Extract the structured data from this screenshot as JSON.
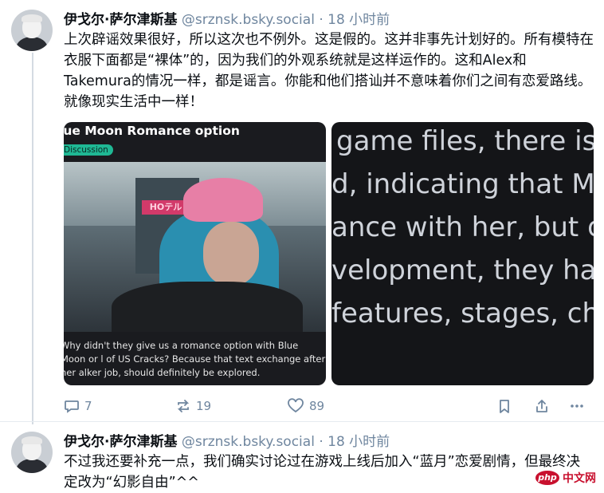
{
  "post1": {
    "display_name": "伊戈尔·萨尔津斯基",
    "handle": "@srznsk.bsky.social",
    "separator": "·",
    "time": "18 小时前",
    "text": "上次辟谣效果很好，所以这次也不例外。这是假的。这并非事先计划好的。所有模特在衣服下面都是“裸体”的，因为我们的外观系统就是这样运作的。这和Alex和Takemura的情况一样，都是谣言。你能和他们搭讪并不意味着你们之间有恋爱路线。就像现实生活中一样！",
    "media_left": {
      "title": "lue Moon Romance option",
      "tag": "Discussion",
      "sign_text": "HOテル",
      "caption": "Why didn't they give us a romance option with Blue Moon or l of US Cracks? Because that text exchange after her alker job, should definitely be explored."
    },
    "media_right": {
      "lines": [
        "game files, there is a",
        "d, indicating that MA",
        "ance with her, but du",
        "velopment, they had",
        " features, stages, ch"
      ]
    },
    "actions": {
      "reply_count": "7",
      "repost_count": "19",
      "like_count": "89"
    }
  },
  "post2": {
    "display_name": "伊戈尔·萨尔津斯基",
    "handle": "@srznsk.bsky.social",
    "separator": "·",
    "time": "18 小时前",
    "text": "不过我还要补充一点，我们确实讨论过在游戏上线后加入“蓝月”恋爱剧情，但最终决定改为“幻影自由”^^"
  },
  "watermark": {
    "logo_text": "php",
    "site_text": "中文网"
  },
  "colors": {
    "muted": "#6f869f",
    "tag_green": "#1fb894",
    "watermark_red": "#c8102e"
  }
}
